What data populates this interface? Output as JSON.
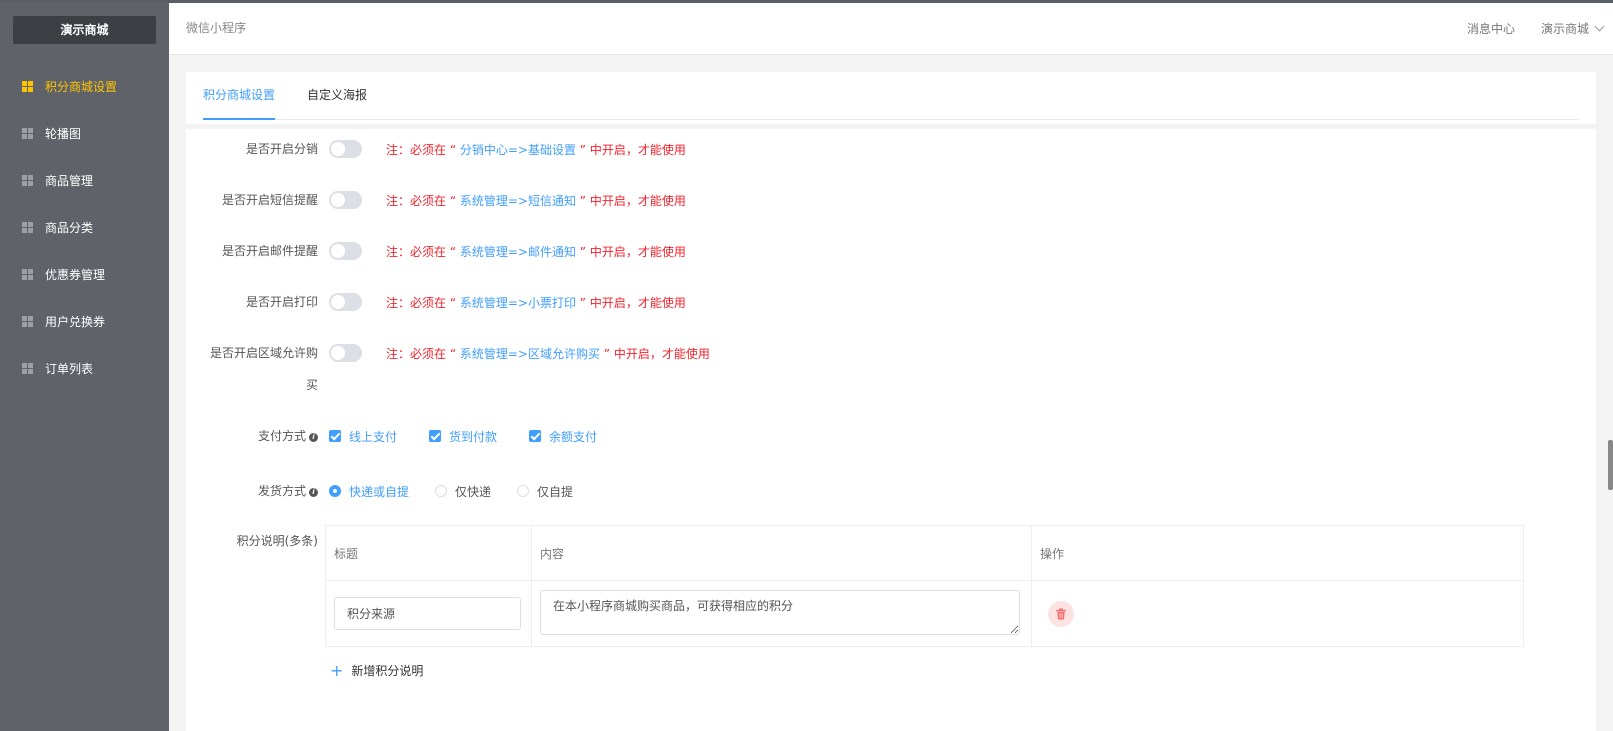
{
  "sidebar": {
    "brand": "演示商城",
    "items": [
      {
        "label": "积分商城设置",
        "active": true
      },
      {
        "label": "轮播图"
      },
      {
        "label": "商品管理"
      },
      {
        "label": "商品分类"
      },
      {
        "label": "优惠券管理"
      },
      {
        "label": "用户兑换券"
      },
      {
        "label": "订单列表"
      }
    ]
  },
  "header": {
    "breadcrumb": "微信小程序",
    "message_center": "消息中心",
    "user_menu": "演示商城"
  },
  "tabs": [
    {
      "label": "积分商城设置",
      "active": true
    },
    {
      "label": "自定义海报"
    }
  ],
  "form": {
    "toggles": [
      {
        "label": "是否开启分销",
        "note_prefix": "注：必须在 “ ",
        "note_path": "分销中心=>基础设置",
        "note_suffix": " ” 中开启，才能使用",
        "on": false
      },
      {
        "label": "是否开启短信提醒",
        "note_prefix": "注：必须在 “ ",
        "note_path": "系统管理=>短信通知",
        "note_suffix": " ” 中开启，才能使用",
        "on": false
      },
      {
        "label": "是否开启邮件提醒",
        "note_prefix": "注：必须在 “ ",
        "note_path": "系统管理=>邮件通知",
        "note_suffix": " ” 中开启，才能使用",
        "on": false
      },
      {
        "label": "是否开启打印",
        "note_prefix": "注：必须在 “ ",
        "note_path": "系统管理=>小票打印",
        "note_suffix": " ” 中开启，才能使用",
        "on": false
      },
      {
        "label_line1": "是否开启区域允许购",
        "label_line2": "买",
        "note_prefix": "注：必须在 “ ",
        "note_path": "系统管理=>区域允许购买",
        "note_suffix": " ” 中开启，才能使用",
        "on": false
      }
    ],
    "payment": {
      "label": "支付方式",
      "options": [
        {
          "label": "线上支付",
          "checked": true
        },
        {
          "label": "货到付款",
          "checked": true
        },
        {
          "label": "余额支付",
          "checked": true
        }
      ]
    },
    "delivery": {
      "label": "发货方式",
      "options": [
        {
          "label": "快递或自提",
          "selected": true
        },
        {
          "label": "仅快递",
          "selected": false
        },
        {
          "label": "仅自提",
          "selected": false
        }
      ]
    },
    "points_desc": {
      "label": "积分说明(多条)",
      "columns": [
        "标题",
        "内容",
        "操作"
      ],
      "rows": [
        {
          "title": "积分来源",
          "content": "在本小程序商城购买商品，可获得相应的积分"
        }
      ],
      "add_label": "新增积分说明"
    }
  },
  "colors": {
    "accent": "#409eff",
    "sidebar_bg": "#5f6369",
    "active_nav": "#ffc400",
    "note_red": "#f5222d"
  }
}
